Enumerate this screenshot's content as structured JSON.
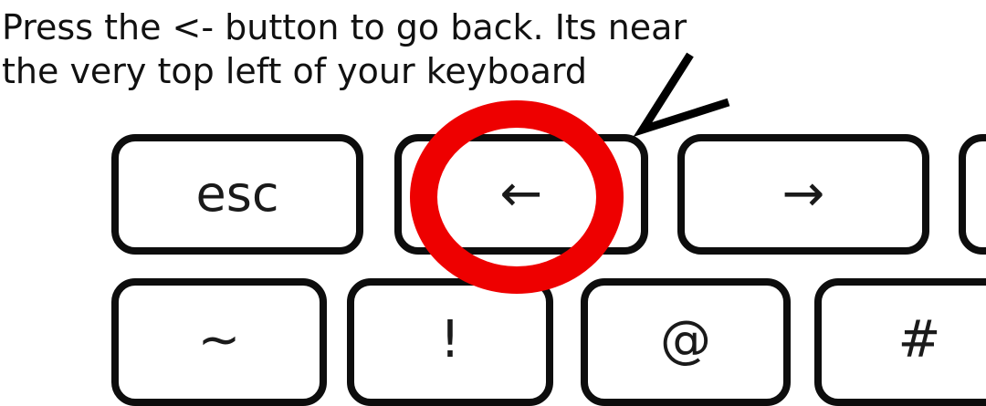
{
  "instruction": {
    "line1": "Press the <- button to go back. Its near",
    "line2": "the very top left of your keyboard"
  },
  "keyboard": {
    "row1": [
      {
        "id": "esc",
        "label": "esc"
      },
      {
        "id": "back",
        "label": "←"
      },
      {
        "id": "forward",
        "label": "→"
      }
    ],
    "row2": [
      {
        "id": "tilde",
        "label": "~"
      },
      {
        "id": "exclamation",
        "label": "!"
      },
      {
        "id": "at",
        "label": "@"
      },
      {
        "id": "hash",
        "label": "#"
      }
    ]
  },
  "annotation": {
    "highlight_color": "#ee0000",
    "pointer_color": "#000000"
  }
}
